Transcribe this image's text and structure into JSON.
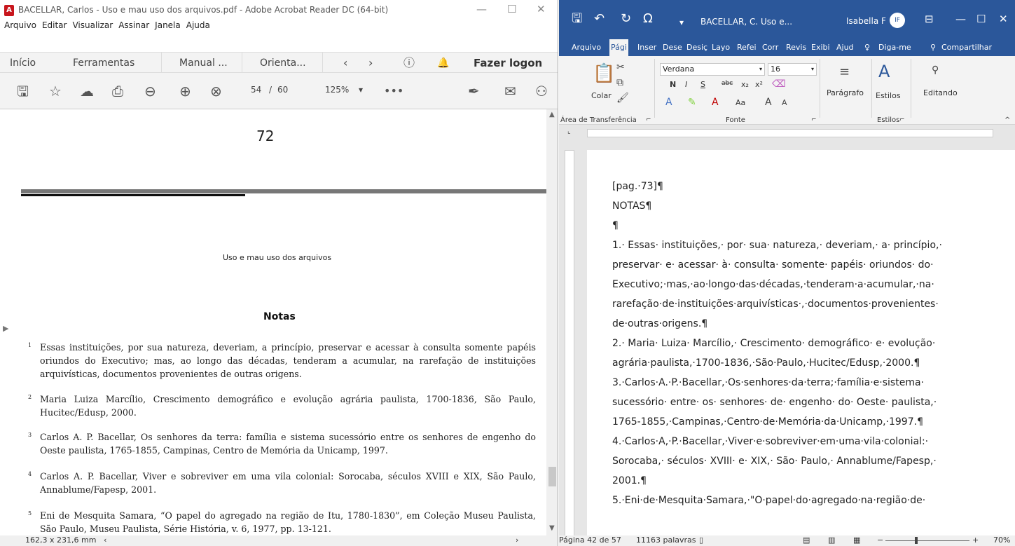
{
  "acrobat": {
    "title": "BACELLAR, Carlos - Uso e mau uso dos arquivos.pdf - Adobe Acrobat Reader DC (64-bit)",
    "menu": [
      "Arquivo",
      "Editar",
      "Visualizar",
      "Assinar",
      "Janela",
      "Ajuda"
    ],
    "tabs": {
      "home": "Início",
      "tools": "Ferramentas",
      "doc1": "Manual ...",
      "doc2": "Orienta...",
      "logon": "Fazer logon"
    },
    "toolbar": {
      "page_current": "54",
      "page_sep": "/",
      "page_total": "60",
      "zoom": "125%"
    },
    "page": {
      "page_number": "72",
      "running_head": "Uso e mau uso dos arquivos",
      "heading": "Notas",
      "footnotes": [
        {
          "num": "1",
          "text": "Essas instituições, por sua natureza, deveriam, a princípio, preservar e acessar à consulta somente papéis oriundos do Executivo; mas, ao longo das décadas, tenderam a acumular, na rarefação de instituições arquivísticas, documentos provenientes de outras origens."
        },
        {
          "num": "2",
          "text": "Maria Luiza Marcílio, Crescimento demográfico e evolução agrária paulista, 1700-1836, São Paulo, Hucitec/Edusp, 2000."
        },
        {
          "num": "3",
          "text": "Carlos A. P. Bacellar, Os senhores da terra: família e sistema sucessório entre os senhores de engenho do Oeste paulista, 1765-1855, Campinas, Centro de Memória da Unicamp, 1997."
        },
        {
          "num": "4",
          "text": "Carlos A. P. Bacellar, Viver e sobreviver em uma vila colonial: Sorocaba, séculos XVIII e XIX, São Paulo, Annablume/Fapesp, 2001."
        },
        {
          "num": "5",
          "text": "Eni de Mesquita Samara, “O papel do agregado na região de Itu, 1780-1830”, em Coleção Museu Paulista, São Paulo, Museu Paulista, Série História, v. 6, 1977, pp. 13-121."
        }
      ]
    },
    "status": "162,3 x 231,6 mm"
  },
  "word": {
    "doc_title": "BACELLAR, C. Uso e...",
    "user": "Isabella F",
    "user_initials": "IF",
    "tabs": [
      "Arquivo",
      "Pági",
      "Inser",
      "Dese",
      "Desiç",
      "Layo",
      "Refei",
      "Corr",
      "Revis",
      "Exibi",
      "Ajud",
      "Diga-me",
      "Compartilhar"
    ],
    "ribbon": {
      "paste": "Colar",
      "clipboard": "Área de Transferência",
      "font_name": "Verdana",
      "font_size": "16",
      "font_group": "Fonte",
      "paragraph": "Parágrafo",
      "styles": "Estilos",
      "styles_group": "Estilos",
      "editing": "Editando",
      "bold": "N",
      "italic": "I",
      "underline": "S",
      "strike": "abc",
      "subscript": "x₂",
      "superscript": "x²",
      "case": "Aa"
    },
    "lines": [
      "[pag.·73]¶",
      "NOTAS¶",
      "¶",
      "1.· Essas· instituições,· por· sua· natureza,· deveriam,· a· princípio,·",
      "preservar· e· acessar· à· consulta· somente· papéis· oriundos· do·",
      "Executivo;·mas,·ao·longo·das·décadas,·tenderam·a·acumular,·na·",
      "rarefação·de·instituições·arquivísticas·,·documentos·provenientes·",
      "de·outras·origens.¶",
      "2.· Maria· Luiza· Marcílio,· Crescimento· demográfico· e· evolução·",
      "agrária·paulista,·1700-1836,·São·Paulo,·Hucitec/Edusp,·2000.¶",
      "3.·Carlos·A.·P.·Bacellar,·Os·senhores·da·terra;·família·e·sistema·",
      "sucessório· entre· os· senhores· de· engenho· do· Oeste· paulista,·",
      "1765-1855,·Campinas,·Centro·de·Memória·da·Unicamp,·1997.¶",
      "4.·Carlos·A,·P.·Bacellar,·Viver·e·sobreviver·em·uma·vila·colonial:·",
      "Sorocaba,· séculos· XVIII· e· XIX,· São· Paulo,· Annablume/Fapesp,·",
      "2001.¶",
      "5.·Eni·de·Mesquita·Samara,·\"O·papel·do·agregado·na·região·de·"
    ],
    "status": {
      "page": "Página 42 de 57",
      "words": "11163 palavras",
      "zoom": "70%"
    }
  }
}
